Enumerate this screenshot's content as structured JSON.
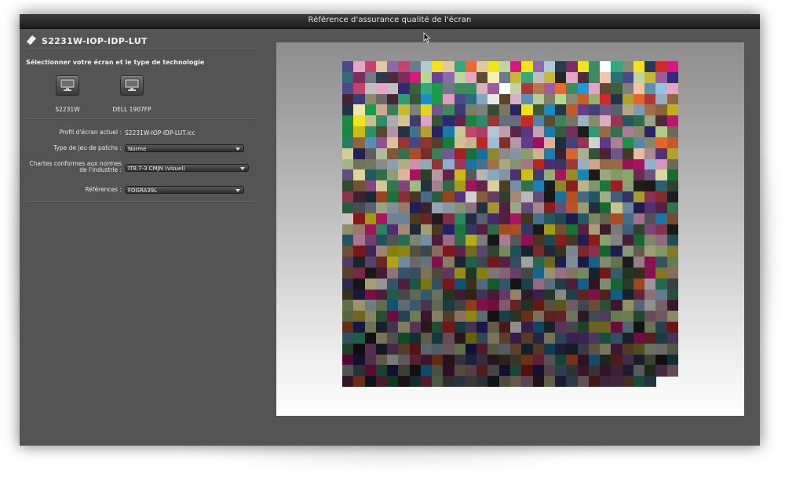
{
  "window": {
    "title": "Référence d'assurance qualité de l'écran"
  },
  "display": {
    "name": "S2231W-IOP-IDP-LUT"
  },
  "section": {
    "title": "Sélectionner votre écran et le type de technologie"
  },
  "monitors": [
    {
      "label": "S2231W"
    },
    {
      "label": "DELL 1907FP"
    }
  ],
  "settings": {
    "profile_label": "Profil d'écran actuel :",
    "profile_value": "S2231W-IOP-IDP-LUT.icc",
    "patchset_label": "Type de jeu de patchs :",
    "patchset_value": "Norme",
    "charts_label": "Chartes conformes aux normes de l'industrie :",
    "charts_value": "IT8.7-3 CMJN (visuel)",
    "references_label": "Références :",
    "references_value": "FOGRA39L"
  },
  "icons": {
    "display": "display-card-icon",
    "monitor": "monitor-icon",
    "cursor": "mouse-pointer-icon",
    "dropdown": "chevron-down-icon"
  },
  "colors": {
    "window_bg": "#545454",
    "titlebar": "#222222",
    "text": "#f0f0f0"
  },
  "patch_chart": {
    "columns": 30,
    "rows": 30,
    "last_row_columns": 28,
    "palette": [
      "#1e9bd7",
      "#d6197c",
      "#f2e31e",
      "#2f2a7a",
      "#1f9a4a",
      "#d42a2a",
      "#6a3f98",
      "#e86a2f",
      "#35a77d",
      "#a05a9e",
      "#9bc1e0",
      "#e6a4c8",
      "#f5f0b0",
      "#b8d88e",
      "#f3c4a8",
      "#c0d4a0",
      "#252525",
      "#7f7f7f",
      "#bfbfbf",
      "#ffffff",
      "#5d8fb0",
      "#c2446e",
      "#c7b835",
      "#4a4a8a",
      "#3f8a5e",
      "#a83a3a",
      "#8a6aa8",
      "#b07a50",
      "#2e6e7a",
      "#7a2e5e",
      "#3c5f3c",
      "#5e4a2e",
      "#2a3b4e",
      "#4e2a3b",
      "#6e7a8a",
      "#8a8a6e",
      "#b0c8d8",
      "#d8b0c0",
      "#c8d8b0",
      "#e0c8a0"
    ]
  }
}
